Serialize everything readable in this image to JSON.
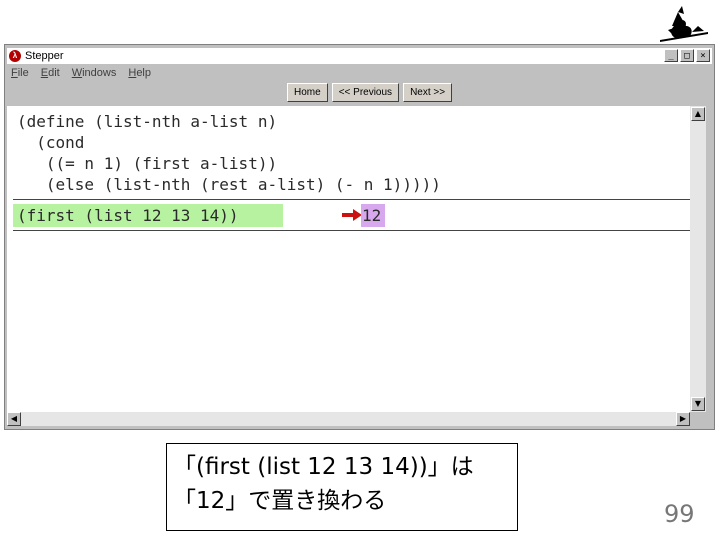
{
  "window": {
    "title": "Stepper",
    "app_icon_glyph": "λ",
    "icon": "racket-lambda-icon",
    "controls": {
      "minimize": "_",
      "maximize": "□",
      "close": "×"
    }
  },
  "menu": [
    "File",
    "Edit",
    "Windows",
    "Help"
  ],
  "nav": {
    "home": "Home",
    "previous": "<< Previous",
    "next": "Next >>"
  },
  "code": {
    "lines": [
      "(define (list-nth a-list n)",
      "  (cond",
      "   ((= n 1) (first a-list))",
      "   (else (list-nth (rest a-list) (- n 1)))))"
    ]
  },
  "step": {
    "redex": "(first (list 12 13 14))",
    "arrow_icon": "red-arrow-icon",
    "result": "12",
    "redex_color": "#b6f2a0",
    "result_color": "#d8a8ee"
  },
  "caption": {
    "line1": "「(first (list 12 13 14))」は",
    "line2": "「12」で置き換わる"
  },
  "page_number": "99",
  "logo": "witch-on-broom-icon"
}
